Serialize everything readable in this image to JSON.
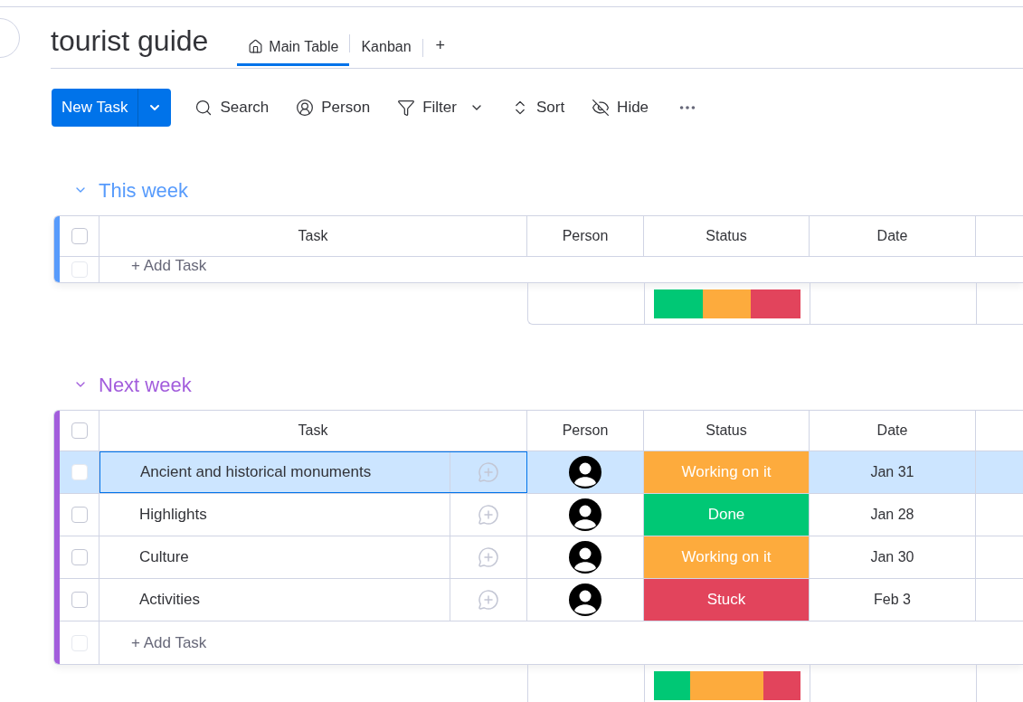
{
  "board": {
    "title": "tourist guide"
  },
  "tabs": [
    {
      "label": "Main Table",
      "selected": true
    },
    {
      "label": "Kanban",
      "selected": false
    }
  ],
  "add_view": "+",
  "toolbar": {
    "new_task": "New Task",
    "items": [
      {
        "kind": "search",
        "label": "Search"
      },
      {
        "kind": "person",
        "label": "Person"
      },
      {
        "kind": "filter",
        "label": "Filter"
      },
      {
        "kind": "sort",
        "label": "Sort"
      },
      {
        "kind": "hide",
        "label": "Hide"
      },
      {
        "kind": "more"
      }
    ]
  },
  "groups": [
    {
      "title": "This week",
      "color": "#579bfc",
      "expanded": true,
      "select_all_checked": false,
      "columns": [
        "Task",
        "Person",
        "Status",
        "Date"
      ],
      "add_task": {
        "label": "+ Add Task",
        "checked": false
      }
    },
    {
      "title": "Next week",
      "color": "#a25ddc",
      "expanded": true,
      "select_all_checked": false,
      "columns": [
        "Task",
        "Person",
        "Status",
        "Date"
      ],
      "rows": [
        {
          "task": "Ancient and historical monuments",
          "status": "Working on it",
          "color": "#fdab3d",
          "date": "Jan 31",
          "selected": true,
          "checked": false
        },
        {
          "task": "Highlights",
          "status": "Done",
          "color": "#00c875",
          "date": "Jan 28",
          "selected": false,
          "checked": false
        },
        {
          "task": "Culture",
          "status": "Working on it",
          "color": "#fdab3d",
          "date": "Jan 30",
          "selected": false,
          "checked": false
        },
        {
          "task": "Activities",
          "status": "Stuck",
          "color": "#e2445c",
          "date": "Feb 3",
          "selected": false,
          "checked": false
        }
      ],
      "add_task": {
        "label": "+ Add Task",
        "checked": false
      }
    }
  ]
}
